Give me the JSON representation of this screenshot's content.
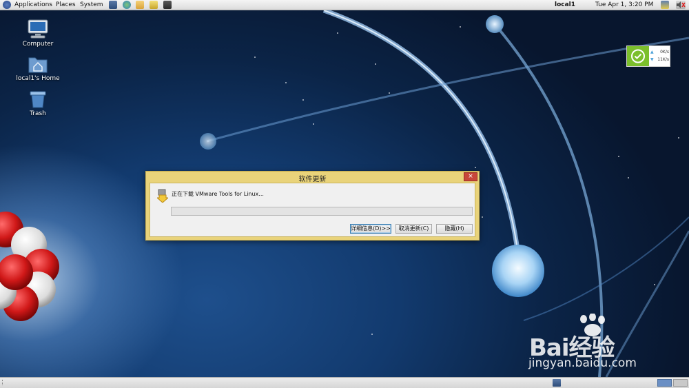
{
  "top_panel": {
    "menus": [
      "Applications",
      "Places",
      "System"
    ],
    "hostname": "local1",
    "clock": "Tue Apr  1,  3:20 PM"
  },
  "desktop_icons": [
    {
      "label": "Computer",
      "icon": "computer-icon"
    },
    {
      "label": "local1's Home",
      "icon": "home-folder-icon"
    },
    {
      "label": "Trash",
      "icon": "trash-icon"
    }
  ],
  "net_widget": {
    "upload": "0K/s",
    "download": "11K/s"
  },
  "dialog": {
    "title": "软件更新",
    "message": "正在下载 VMware Tools for Linux...",
    "progress": 0,
    "buttons": {
      "details": "详细信息(D)>>",
      "cancel": "取消更新(C)",
      "hide": "隐藏(H)"
    },
    "close_glyph": "×"
  },
  "watermark": {
    "logo": "Bai经验",
    "url": "jingyan.baidu.com"
  },
  "colors": {
    "dialog_frame": "#e9d37a",
    "close_button": "#c7463a",
    "net_ok": "#7cbf2c"
  }
}
